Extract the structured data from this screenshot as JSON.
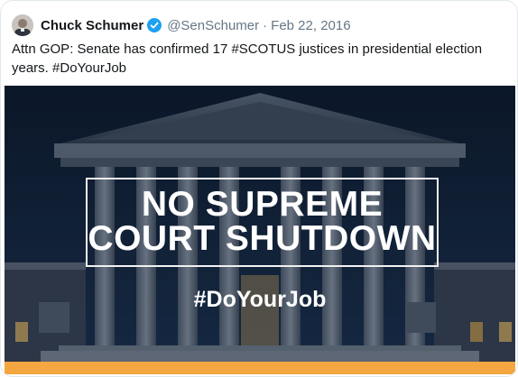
{
  "tweet": {
    "author": {
      "name": "Chuck Schumer",
      "handle": "@SenSchumer",
      "date": "Feb 22, 2016",
      "separator": "·",
      "verified": true,
      "verified_icon": "verified-badge-icon"
    },
    "text": "Attn GOP: Senate has confirmed 17 #SCOTUS justices in presidential election years. #DoYourJob",
    "media": {
      "headline": "NO SUPREME COURT SHUTDOWN",
      "hashtag": "#DoYourJob",
      "accent_color": "#f4a640"
    }
  }
}
